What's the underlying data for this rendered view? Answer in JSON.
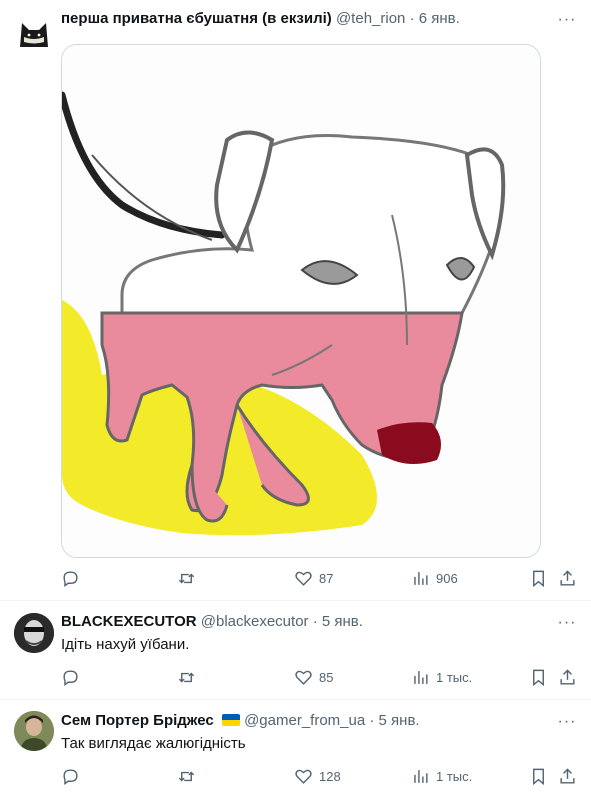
{
  "tweets": [
    {
      "author_name": "перша приватна єбушатня (в екзилі)",
      "handle": "@teh_rion",
      "separator": "·",
      "time": "6 янв.",
      "text": "",
      "stats": {
        "replies": "",
        "retweets": "",
        "likes": "87",
        "views": "906"
      },
      "avatar_icon": "black-cat-avatar-icon",
      "has_media": true
    },
    {
      "author_name": "BLACKEXECUTOR",
      "handle": "@blackexecutor",
      "separator": "·",
      "time": "5 янв.",
      "text": "Ідіть нахуй уїбани.",
      "stats": {
        "replies": "",
        "retweets": "",
        "likes": "85",
        "views": "1 тыс."
      },
      "avatar_icon": "face-photo-avatar-icon"
    },
    {
      "author_name": "Сем Портер Бріджес",
      "handle": "@gamer_from_ua",
      "separator": "·",
      "time": "5 янв.",
      "text": "Так виглядає жалюгідність",
      "stats": {
        "replies": "",
        "retweets": "",
        "likes": "128",
        "views": "1 тыс."
      },
      "avatar_icon": "person-photo-avatar-icon",
      "badge_icon": "ukraine-flag-icon"
    }
  ],
  "more_label": "···",
  "colors": {
    "secondary_text": "#536471",
    "divider": "#eff3f4",
    "flag_blue": "#005bbb",
    "flag_yellow": "#ffd500"
  }
}
